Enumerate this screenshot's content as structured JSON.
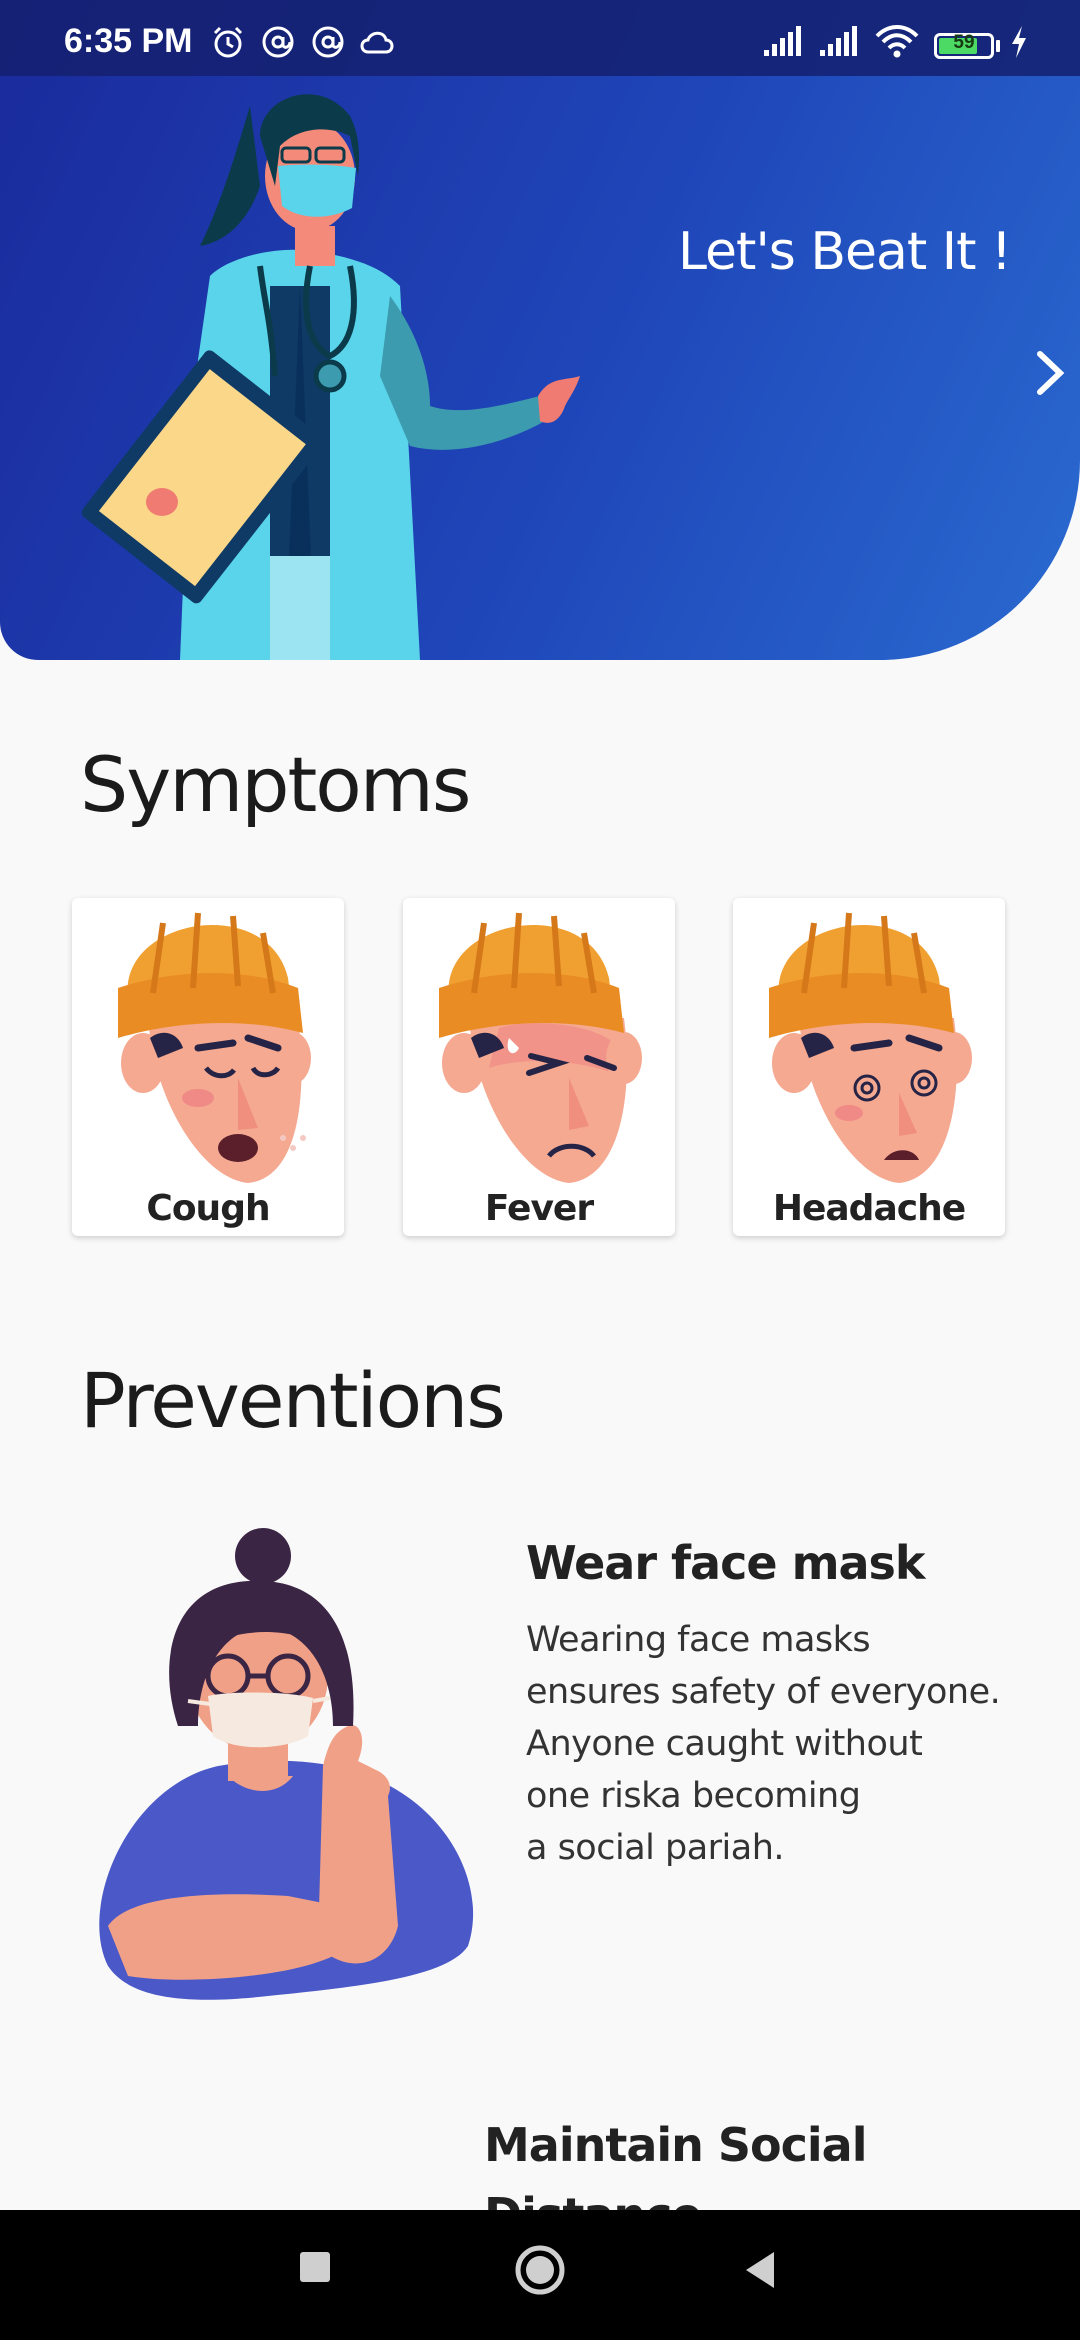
{
  "status_bar": {
    "time": "6:35 PM",
    "battery_level": "59",
    "icons": [
      "alarm-icon",
      "at-icon",
      "at-icon",
      "cloud-icon",
      "signal-icon",
      "signal-icon",
      "wifi-icon",
      "battery-icon",
      "charging-icon"
    ]
  },
  "hero": {
    "title": "Let's Beat It !",
    "next_icon": "chevron-right-icon"
  },
  "symptoms": {
    "title": "Symptoms",
    "items": [
      {
        "label": "Cough"
      },
      {
        "label": "Fever"
      },
      {
        "label": "Headache"
      }
    ]
  },
  "preventions": {
    "title": "Preventions",
    "items": [
      {
        "title": "Wear face mask",
        "description": "Wearing face masks\nensures safety of everyone.\nAnyone caught without\none riska becoming\na social pariah."
      },
      {
        "title": "Maintain Social\n Distance"
      }
    ]
  },
  "nav_bar": {
    "buttons": [
      "recents-icon",
      "home-icon",
      "back-icon"
    ]
  },
  "colors": {
    "hero_start": "#1a2a9c",
    "hero_end": "#2a6ad0",
    "background": "#f9f9f9",
    "hat": "#f0a030",
    "skin": "#f5a991",
    "shirt_blue": "#4b59c8"
  }
}
